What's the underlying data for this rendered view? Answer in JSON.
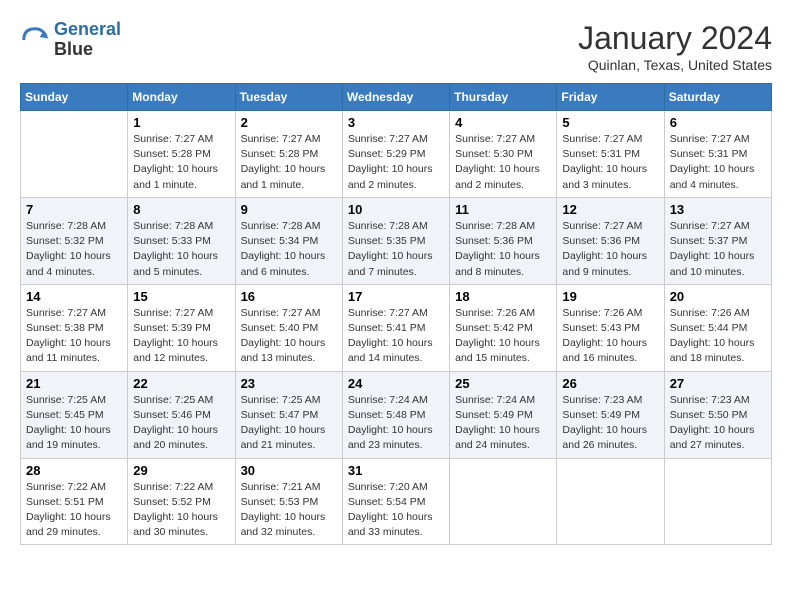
{
  "header": {
    "logo_line1": "General",
    "logo_line2": "Blue",
    "month_title": "January 2024",
    "location": "Quinlan, Texas, United States"
  },
  "days_of_week": [
    "Sunday",
    "Monday",
    "Tuesday",
    "Wednesday",
    "Thursday",
    "Friday",
    "Saturday"
  ],
  "weeks": [
    [
      {
        "day": "",
        "info": ""
      },
      {
        "day": "1",
        "info": "Sunrise: 7:27 AM\nSunset: 5:28 PM\nDaylight: 10 hours\nand 1 minute."
      },
      {
        "day": "2",
        "info": "Sunrise: 7:27 AM\nSunset: 5:28 PM\nDaylight: 10 hours\nand 1 minute."
      },
      {
        "day": "3",
        "info": "Sunrise: 7:27 AM\nSunset: 5:29 PM\nDaylight: 10 hours\nand 2 minutes."
      },
      {
        "day": "4",
        "info": "Sunrise: 7:27 AM\nSunset: 5:30 PM\nDaylight: 10 hours\nand 2 minutes."
      },
      {
        "day": "5",
        "info": "Sunrise: 7:27 AM\nSunset: 5:31 PM\nDaylight: 10 hours\nand 3 minutes."
      },
      {
        "day": "6",
        "info": "Sunrise: 7:27 AM\nSunset: 5:31 PM\nDaylight: 10 hours\nand 4 minutes."
      }
    ],
    [
      {
        "day": "7",
        "info": "Sunrise: 7:28 AM\nSunset: 5:32 PM\nDaylight: 10 hours\nand 4 minutes."
      },
      {
        "day": "8",
        "info": "Sunrise: 7:28 AM\nSunset: 5:33 PM\nDaylight: 10 hours\nand 5 minutes."
      },
      {
        "day": "9",
        "info": "Sunrise: 7:28 AM\nSunset: 5:34 PM\nDaylight: 10 hours\nand 6 minutes."
      },
      {
        "day": "10",
        "info": "Sunrise: 7:28 AM\nSunset: 5:35 PM\nDaylight: 10 hours\nand 7 minutes."
      },
      {
        "day": "11",
        "info": "Sunrise: 7:28 AM\nSunset: 5:36 PM\nDaylight: 10 hours\nand 8 minutes."
      },
      {
        "day": "12",
        "info": "Sunrise: 7:27 AM\nSunset: 5:36 PM\nDaylight: 10 hours\nand 9 minutes."
      },
      {
        "day": "13",
        "info": "Sunrise: 7:27 AM\nSunset: 5:37 PM\nDaylight: 10 hours\nand 10 minutes."
      }
    ],
    [
      {
        "day": "14",
        "info": "Sunrise: 7:27 AM\nSunset: 5:38 PM\nDaylight: 10 hours\nand 11 minutes."
      },
      {
        "day": "15",
        "info": "Sunrise: 7:27 AM\nSunset: 5:39 PM\nDaylight: 10 hours\nand 12 minutes."
      },
      {
        "day": "16",
        "info": "Sunrise: 7:27 AM\nSunset: 5:40 PM\nDaylight: 10 hours\nand 13 minutes."
      },
      {
        "day": "17",
        "info": "Sunrise: 7:27 AM\nSunset: 5:41 PM\nDaylight: 10 hours\nand 14 minutes."
      },
      {
        "day": "18",
        "info": "Sunrise: 7:26 AM\nSunset: 5:42 PM\nDaylight: 10 hours\nand 15 minutes."
      },
      {
        "day": "19",
        "info": "Sunrise: 7:26 AM\nSunset: 5:43 PM\nDaylight: 10 hours\nand 16 minutes."
      },
      {
        "day": "20",
        "info": "Sunrise: 7:26 AM\nSunset: 5:44 PM\nDaylight: 10 hours\nand 18 minutes."
      }
    ],
    [
      {
        "day": "21",
        "info": "Sunrise: 7:25 AM\nSunset: 5:45 PM\nDaylight: 10 hours\nand 19 minutes."
      },
      {
        "day": "22",
        "info": "Sunrise: 7:25 AM\nSunset: 5:46 PM\nDaylight: 10 hours\nand 20 minutes."
      },
      {
        "day": "23",
        "info": "Sunrise: 7:25 AM\nSunset: 5:47 PM\nDaylight: 10 hours\nand 21 minutes."
      },
      {
        "day": "24",
        "info": "Sunrise: 7:24 AM\nSunset: 5:48 PM\nDaylight: 10 hours\nand 23 minutes."
      },
      {
        "day": "25",
        "info": "Sunrise: 7:24 AM\nSunset: 5:49 PM\nDaylight: 10 hours\nand 24 minutes."
      },
      {
        "day": "26",
        "info": "Sunrise: 7:23 AM\nSunset: 5:49 PM\nDaylight: 10 hours\nand 26 minutes."
      },
      {
        "day": "27",
        "info": "Sunrise: 7:23 AM\nSunset: 5:50 PM\nDaylight: 10 hours\nand 27 minutes."
      }
    ],
    [
      {
        "day": "28",
        "info": "Sunrise: 7:22 AM\nSunset: 5:51 PM\nDaylight: 10 hours\nand 29 minutes."
      },
      {
        "day": "29",
        "info": "Sunrise: 7:22 AM\nSunset: 5:52 PM\nDaylight: 10 hours\nand 30 minutes."
      },
      {
        "day": "30",
        "info": "Sunrise: 7:21 AM\nSunset: 5:53 PM\nDaylight: 10 hours\nand 32 minutes."
      },
      {
        "day": "31",
        "info": "Sunrise: 7:20 AM\nSunset: 5:54 PM\nDaylight: 10 hours\nand 33 minutes."
      },
      {
        "day": "",
        "info": ""
      },
      {
        "day": "",
        "info": ""
      },
      {
        "day": "",
        "info": ""
      }
    ]
  ]
}
